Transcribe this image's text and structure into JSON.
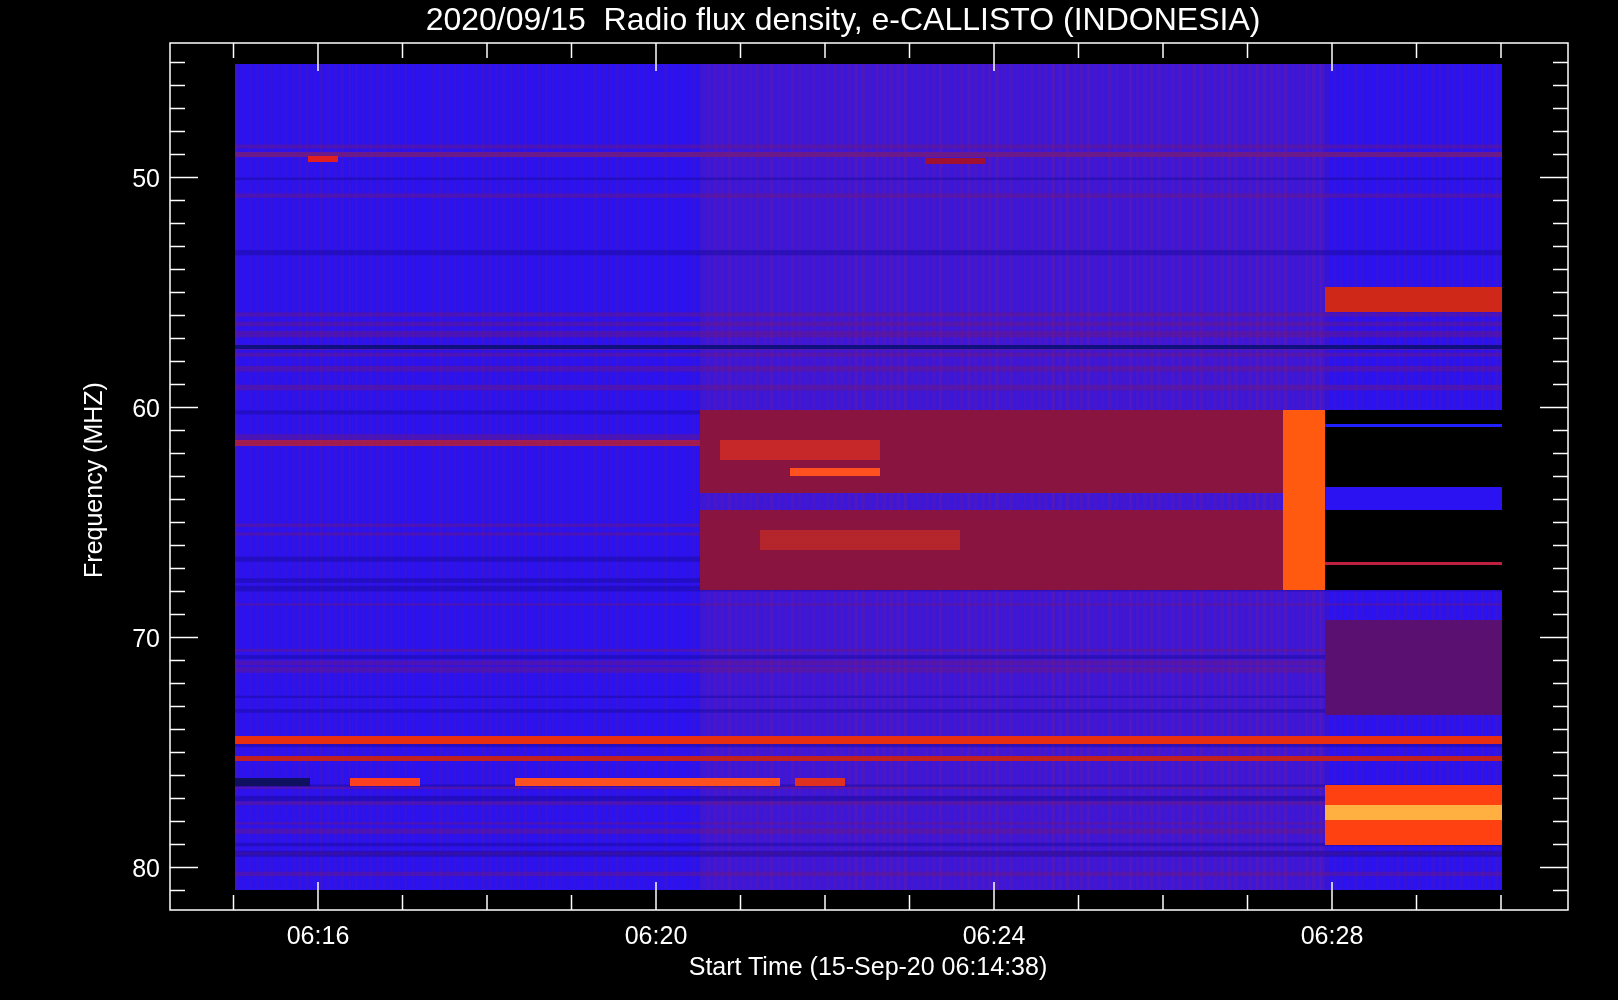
{
  "title": "2020/09/15  Radio flux density, e-CALLISTO (INDONESIA)",
  "y_axis": {
    "label": "Frequency (MHZ)",
    "ticks": [
      "50",
      "60",
      "70",
      "80"
    ]
  },
  "x_axis": {
    "label": "Start Time (15-Sep-20 06:14:38)",
    "ticks": [
      "06:16",
      "06:20",
      "06:24",
      "06:28"
    ]
  }
}
